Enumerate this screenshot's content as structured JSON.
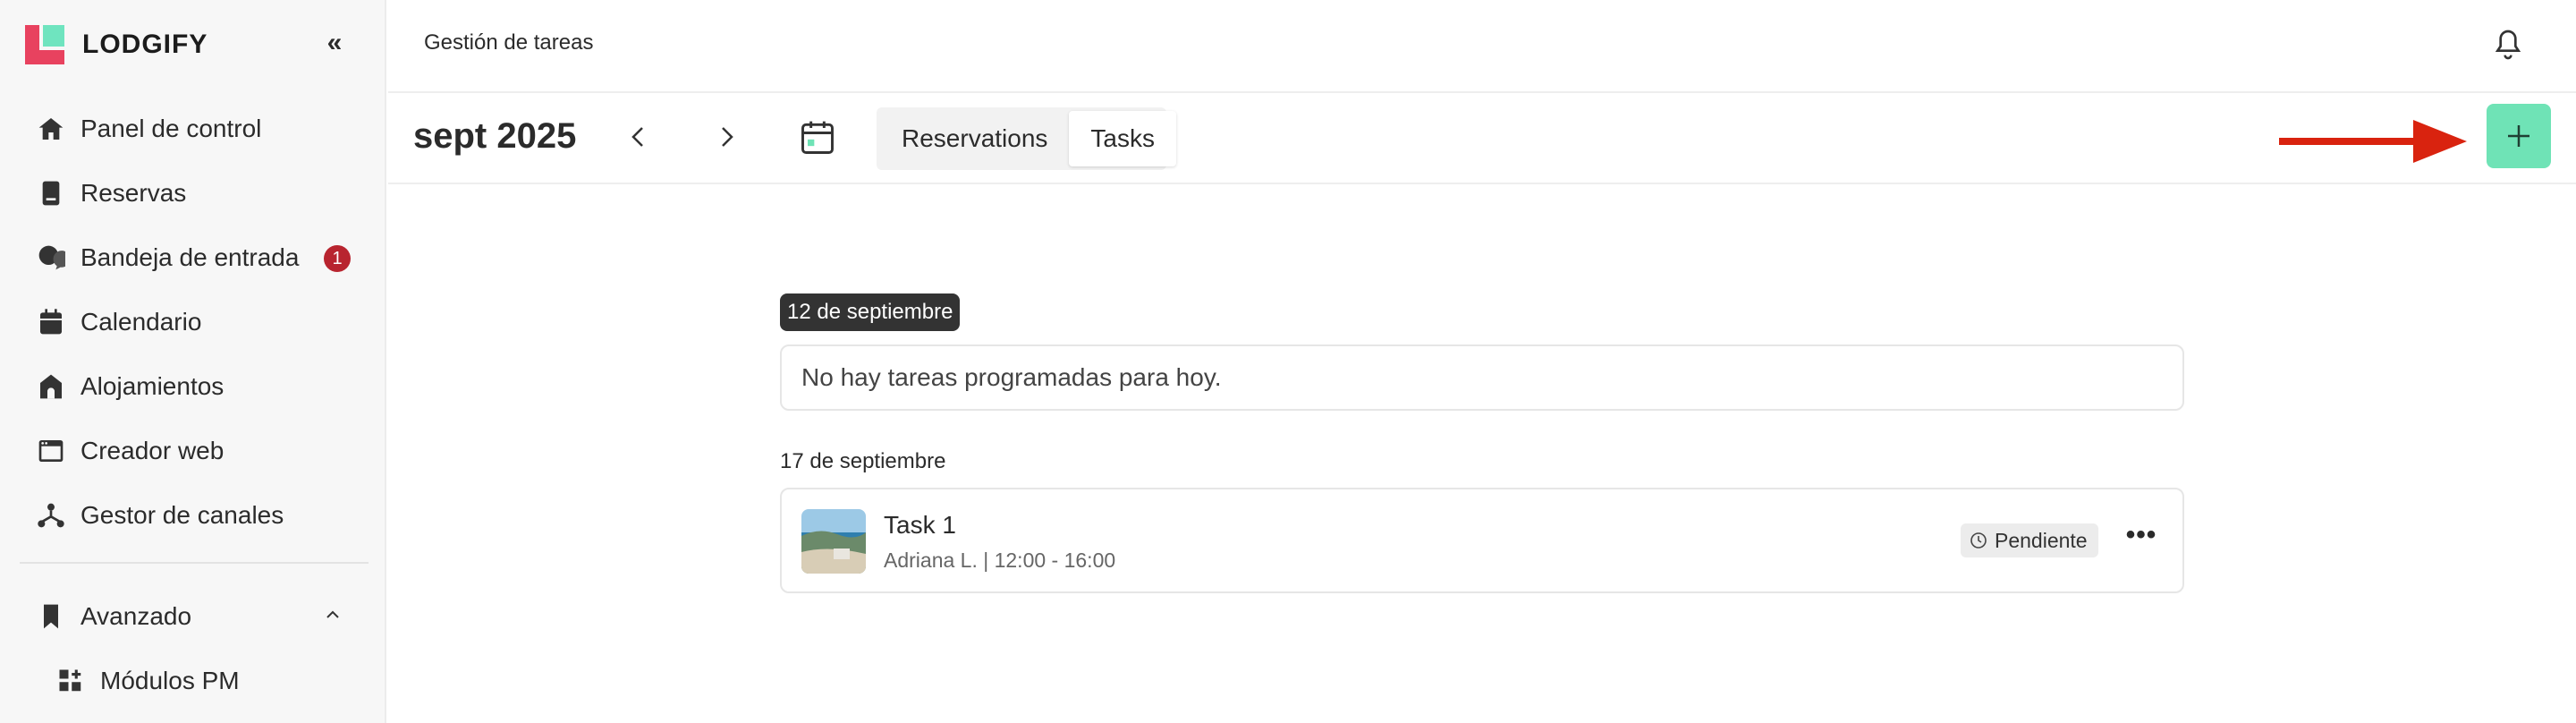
{
  "app": {
    "brand": "LODGIFY",
    "collapse_icon": "double-chevron-left-icon"
  },
  "sidebar": {
    "items": [
      {
        "label": "Panel de control",
        "icon": "home-icon"
      },
      {
        "label": "Reservas",
        "icon": "book-icon"
      },
      {
        "label": "Bandeja de entrada",
        "icon": "chat-icon",
        "badge": "1"
      },
      {
        "label": "Calendario",
        "icon": "calendar-icon"
      },
      {
        "label": "Alojamientos",
        "icon": "house-icon"
      },
      {
        "label": "Creador web",
        "icon": "browser-icon"
      },
      {
        "label": "Gestor de canales",
        "icon": "network-icon"
      }
    ],
    "advanced": {
      "label": "Avanzado",
      "icon": "bookmark-icon",
      "expanded": true
    },
    "sub_items": [
      {
        "label": "Módulos PM",
        "icon": "modules-icon"
      }
    ]
  },
  "header": {
    "title": "Gestión de tareas",
    "bell_icon": "bell-icon"
  },
  "toolbar": {
    "month": "sept 2025",
    "prev_icon": "chevron-left-icon",
    "next_icon": "chevron-right-icon",
    "calendar_icon": "calendar-today-icon",
    "tabs": [
      {
        "label": "Reservations",
        "active": false
      },
      {
        "label": "Tasks",
        "active": true
      }
    ],
    "add_label": "+"
  },
  "content": {
    "days": [
      {
        "date": "12 de septiembre",
        "highlighted": true,
        "empty_text": "No hay tareas programadas para hoy."
      },
      {
        "date": "17 de septiembre",
        "highlighted": false,
        "tasks": [
          {
            "title": "Task 1",
            "subtitle": "Adriana L. | 12:00 - 16:00",
            "status": "Pendiente",
            "more": "•••"
          }
        ]
      }
    ]
  },
  "colors": {
    "brand_red": "#e8425f",
    "brand_mint": "#6fe4bf",
    "add_button": "#6fe3b6",
    "badge": "#b8242f",
    "annotation_arrow": "#d9230f"
  }
}
